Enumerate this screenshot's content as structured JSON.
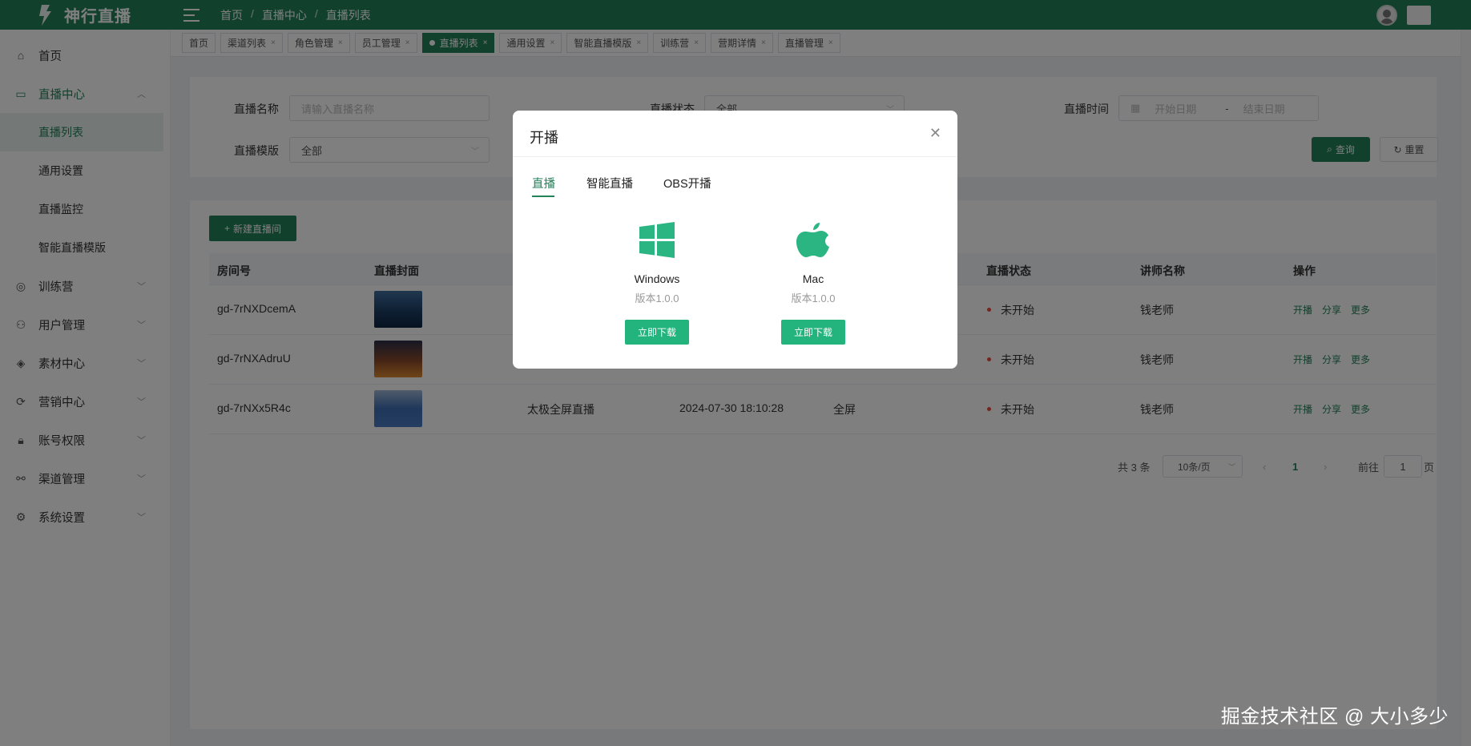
{
  "brand": {
    "name": "神行直播"
  },
  "breadcrumb": [
    "首页",
    "直播中心",
    "直播列表"
  ],
  "sidebar": {
    "items": [
      {
        "label": "首页",
        "icon": "home-icon"
      },
      {
        "label": "直播中心",
        "icon": "video-icon",
        "open": true
      },
      {
        "label": "训练营",
        "icon": "target-icon"
      },
      {
        "label": "用户管理",
        "icon": "users-icon"
      },
      {
        "label": "素材中心",
        "icon": "layers-icon"
      },
      {
        "label": "营销中心",
        "icon": "marketing-icon"
      },
      {
        "label": "账号权限",
        "icon": "lock-icon"
      },
      {
        "label": "渠道管理",
        "icon": "channel-icon"
      },
      {
        "label": "系统设置",
        "icon": "gear-icon"
      }
    ],
    "sub_items": [
      "直播列表",
      "通用设置",
      "直播监控",
      "智能直播模版"
    ]
  },
  "tags": [
    "首页",
    "渠道列表",
    "角色管理",
    "员工管理",
    "直播列表",
    "通用设置",
    "智能直播模版",
    "训练营",
    "营期详情",
    "直播管理"
  ],
  "filters": {
    "name_label": "直播名称",
    "name_placeholder": "请输入直播名称",
    "status_label": "直播状态",
    "status_value": "全部",
    "time_label": "直播时间",
    "start_placeholder": "开始日期",
    "range_sep": "-",
    "end_placeholder": "结束日期",
    "template_label": "直播模版",
    "template_value": "全部",
    "query_label": "查询",
    "reset_label": "重置"
  },
  "table": {
    "new_button": "新建直播间",
    "columns": {
      "room": "房间号",
      "cover": "直播封面",
      "status": "直播状态",
      "teacher": "讲师名称",
      "ops": "操作"
    },
    "rows": [
      {
        "room": "gd-7rNXDcemA",
        "title": "",
        "time": "",
        "mode": "",
        "status": "未开始",
        "teacher": "钱老师"
      },
      {
        "room": "gd-7rNXAdruU",
        "title": "",
        "time": "",
        "mode": "",
        "status": "未开始",
        "teacher": "钱老师"
      },
      {
        "room": "gd-7rNXx5R4c",
        "title": "太极全屏直播",
        "time": "2024-07-30 18:10:28",
        "mode": "全屏",
        "status": "未开始",
        "teacher": "钱老师"
      }
    ],
    "ops": [
      "开播",
      "分享",
      "更多"
    ]
  },
  "pager": {
    "total": "共 3 条",
    "page_size": "10条/页",
    "current": "1",
    "goto": "前往",
    "goto_value": "1",
    "page_unit": "页"
  },
  "dialog": {
    "title": "开播",
    "tabs": [
      "直播",
      "智能直播",
      "OBS开播"
    ],
    "downloads": [
      {
        "name": "Windows",
        "version": "版本1.0.0",
        "button": "立即下载",
        "icon": "windows-icon"
      },
      {
        "name": "Mac",
        "version": "版本1.0.0",
        "button": "立即下载",
        "icon": "apple-icon"
      }
    ]
  },
  "watermark": "掘金技术社区 @ 大小多少",
  "colors": {
    "primary": "#23815a",
    "accent": "#23b37c",
    "status_dot": "#e74c3c"
  }
}
